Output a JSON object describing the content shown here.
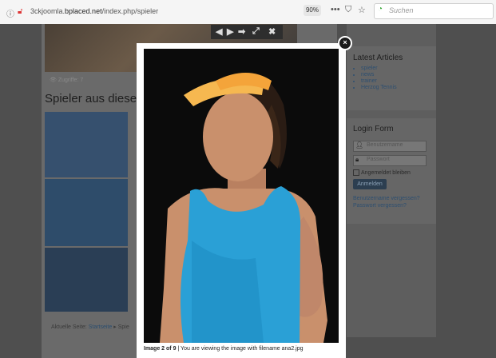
{
  "browser": {
    "url_prefix": "3ckjoomla.",
    "url_domain": "bplaced.net",
    "url_path": "/index.php/spieler",
    "zoom": "90%",
    "search_placeholder": "Suchen"
  },
  "page": {
    "meta": "Zugriffe: 7",
    "title": "Spieler aus dieser",
    "breadcrumb_label": "Aktuelle Seite:",
    "breadcrumb_home": "Startseite",
    "breadcrumb_sep": "▸",
    "breadcrumb_current": "Spie"
  },
  "sidebar": {
    "latest_title": "Latest Articles",
    "latest_items": [
      "spieler",
      "news",
      "trainer",
      "Herzog Tennis"
    ],
    "login_title": "Login Form",
    "username_placeholder": "Benutzername",
    "password_placeholder": "Passwort",
    "remember_label": "Angemeldet bleiben",
    "login_button": "Anmelden",
    "forgot_username": "Benutzername vergessen?",
    "forgot_password": "Passwort vergessen?"
  },
  "lightbox": {
    "caption_bold": "Image 2 of 9",
    "caption_rest": " | You are viewing the image with filename ana2.jpg",
    "close_glyph": "×",
    "prev_glyph": "◀",
    "play_glyph": "▶",
    "next_glyph": "➡",
    "expand_glyph": "⤢",
    "close_tool_glyph": "✖"
  },
  "colors": {
    "shirt": "#2aa0d6",
    "visor": "#f6b850",
    "skin": "#c9906c",
    "overlay_bg": "#4f4f4f"
  }
}
